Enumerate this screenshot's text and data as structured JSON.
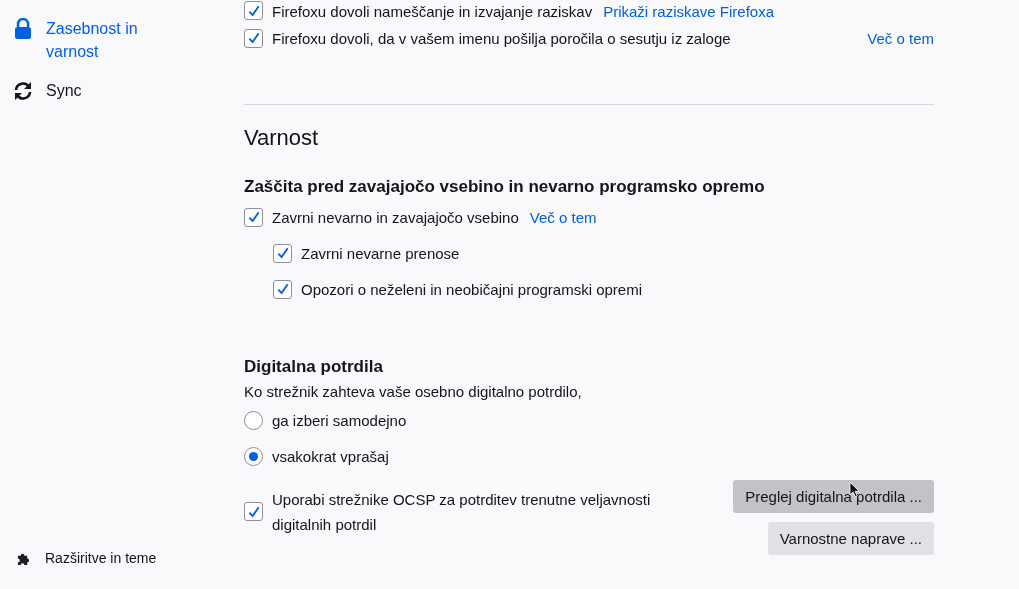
{
  "sidebar": {
    "items": [
      {
        "label": "Zasebnost in varnost",
        "kind": "lock",
        "selected": true
      },
      {
        "label": "Sync",
        "kind": "sync",
        "selected": false
      }
    ],
    "footer_items": [
      {
        "label": "Razširitve in teme",
        "kind": "puzzle"
      }
    ]
  },
  "top_options": [
    {
      "label": "Firefoxu dovoli nameščanje in izvajanje raziskav",
      "checked": true,
      "link": "Prikaži raziskave Firefoxa",
      "kind": "inline"
    },
    {
      "label": "Firefoxu dovoli, da v vašem imenu pošilja poročila o sesutju iz zaloge",
      "checked": true,
      "link": "Več o tem",
      "kind": "right"
    }
  ],
  "section": {
    "title": "Varnost",
    "groups": [
      {
        "heading": "Zaščita pred zavajajočo vsebino in nevarno programsko opremo",
        "options": [
          {
            "label": "Zavrni nevarno in zavajajočo vsebino",
            "checked": true,
            "link": "Več o tem",
            "children": [
              {
                "label": "Zavrni nevarne prenose",
                "checked": true
              },
              {
                "label": "Opozori o neželeni in neobičajni programski opremi",
                "checked": true
              }
            ]
          }
        ]
      },
      {
        "heading": "Digitalna potrdila",
        "description": "Ko strežnik zahteva vaše osebno digitalno potrdilo,",
        "radios": [
          {
            "label": "ga izberi samodejno",
            "selected": false
          },
          {
            "label": "vsakokrat vprašaj",
            "selected": true
          }
        ],
        "ocsp": {
          "label": "Uporabi strežnike OCSP za potrditev trenutne veljavnosti digitalnih potrdil",
          "checked": true
        },
        "buttons": [
          {
            "label": "Preglej digitalna potrdila ...",
            "hovered": true
          },
          {
            "label": "Varnostne naprave ...",
            "hovered": false
          }
        ]
      }
    ]
  }
}
